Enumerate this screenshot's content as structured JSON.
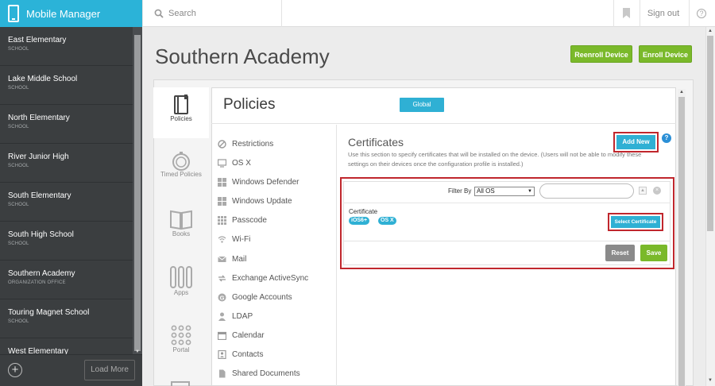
{
  "app": {
    "title": "Mobile Manager"
  },
  "topbar": {
    "search_placeholder": "Search",
    "signout": "Sign out",
    "help": "?"
  },
  "sidebar": {
    "items": [
      {
        "name": "East Elementary",
        "type": "SCHOOL"
      },
      {
        "name": "Lake Middle School",
        "type": "SCHOOL"
      },
      {
        "name": "North Elementary",
        "type": "SCHOOL"
      },
      {
        "name": "River Junior High",
        "type": "SCHOOL"
      },
      {
        "name": "South Elementary",
        "type": "SCHOOL"
      },
      {
        "name": "South High School",
        "type": "SCHOOL"
      },
      {
        "name": "Southern Academy",
        "type": "ORGANIZATION OFFICE"
      },
      {
        "name": "Touring Magnet School",
        "type": "SCHOOL"
      },
      {
        "name": "West Elementary",
        "type": ""
      }
    ],
    "load_more": "Load More",
    "add": "+"
  },
  "page": {
    "title": "Southern Academy",
    "reenroll": "Reenroll Device",
    "enroll": "Enroll Device"
  },
  "tabs": [
    {
      "label": "Policies",
      "icon": "policies-icon",
      "active": true
    },
    {
      "label": "Timed Policies",
      "icon": "timer-icon",
      "active": false
    },
    {
      "label": "Books",
      "icon": "book-icon",
      "active": false
    },
    {
      "label": "Apps",
      "icon": "apps-icon",
      "active": false
    },
    {
      "label": "Portal",
      "icon": "portal-grid-icon",
      "active": false
    }
  ],
  "policies": {
    "title": "Policies",
    "global": "Global",
    "list": [
      {
        "label": "Restrictions",
        "icon": "restrictions-icon"
      },
      {
        "label": "OS X",
        "icon": "monitor-icon"
      },
      {
        "label": "Windows Defender",
        "icon": "windows-icon"
      },
      {
        "label": "Windows Update",
        "icon": "windows-icon"
      },
      {
        "label": "Passcode",
        "icon": "keypad-icon"
      },
      {
        "label": "Wi-Fi",
        "icon": "wifi-icon"
      },
      {
        "label": "Mail",
        "icon": "mail-icon"
      },
      {
        "label": "Exchange ActiveSync",
        "icon": "sync-icon"
      },
      {
        "label": "Google Accounts",
        "icon": "google-icon"
      },
      {
        "label": "LDAP",
        "icon": "person-icon"
      },
      {
        "label": "Calendar",
        "icon": "calendar-icon"
      },
      {
        "label": "Contacts",
        "icon": "contacts-icon"
      },
      {
        "label": "Shared Documents",
        "icon": "document-icon"
      }
    ]
  },
  "certificates": {
    "title": "Certificates",
    "description": "Use this section to specify certificates that will be installed on the device. (Users will not be able to modify these settings on their devices once the configuration profile is installed.)",
    "add_new": "Add New",
    "help": "?",
    "filter_label": "Filter By",
    "filter_value": "All OS",
    "row_label": "Certificate",
    "badges": [
      "iOS6+",
      "OS X"
    ],
    "select_certificate": "Select Certificate",
    "reset": "Reset",
    "save": "Save"
  },
  "colors": {
    "brand": "#2bb3d8",
    "green": "#7ab92a",
    "highlight": "#c0272d",
    "sidebar": "#3b3e40"
  }
}
